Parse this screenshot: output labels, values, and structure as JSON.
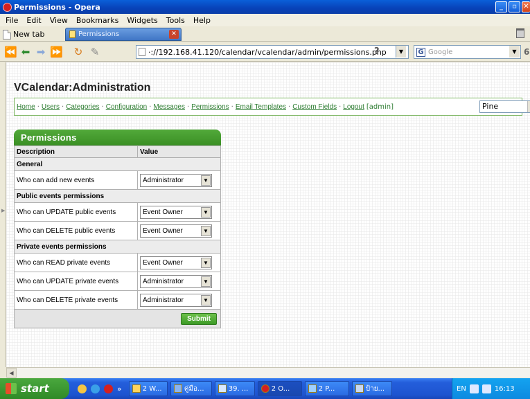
{
  "window": {
    "title": "Permissions - Opera"
  },
  "menu": [
    "File",
    "Edit",
    "View",
    "Bookmarks",
    "Widgets",
    "Tools",
    "Help"
  ],
  "tabs": {
    "new_tab_label": "New tab",
    "active_tab_label": "Permissions"
  },
  "address": {
    "url": "·://192.168.41.120/calendar/vcalendar/admin/permissions.php",
    "help": "?",
    "search_placeholder": "Google"
  },
  "page": {
    "title": "VCalendar:Administration",
    "nav": {
      "links": [
        "Home",
        "Users",
        "Categories",
        "Configuration",
        "Messages",
        "Permissions",
        "Email Templates",
        "Custom Fields",
        "Logout"
      ],
      "admin_label": "[admin]",
      "style_select": "Pine"
    },
    "permissions": {
      "header": "Permissions",
      "col_description": "Description",
      "col_value": "Value",
      "sections": [
        {
          "title": "General",
          "rows": [
            {
              "label": "Who can add new events",
              "value": "Administrator"
            }
          ]
        },
        {
          "title": "Public events permissions",
          "rows": [
            {
              "label": "Who can UPDATE public events",
              "value": "Event Owner"
            },
            {
              "label": "Who can DELETE public events",
              "value": "Event Owner"
            }
          ]
        },
        {
          "title": "Private events permissions",
          "rows": [
            {
              "label": "Who can READ private events",
              "value": "Event Owner"
            },
            {
              "label": "Who can UPDATE private events",
              "value": "Administrator"
            },
            {
              "label": "Who can DELETE private events",
              "value": "Administrator"
            }
          ]
        }
      ],
      "submit_label": "Submit"
    }
  },
  "taskbar": {
    "start_label": "start",
    "chevron": "»",
    "items": [
      "2 W...",
      "คู่มือ...",
      "39. ...",
      "2 O...",
      "2 P...",
      "ป้าย..."
    ],
    "tray_lang": "EN",
    "clock": "16:13"
  }
}
